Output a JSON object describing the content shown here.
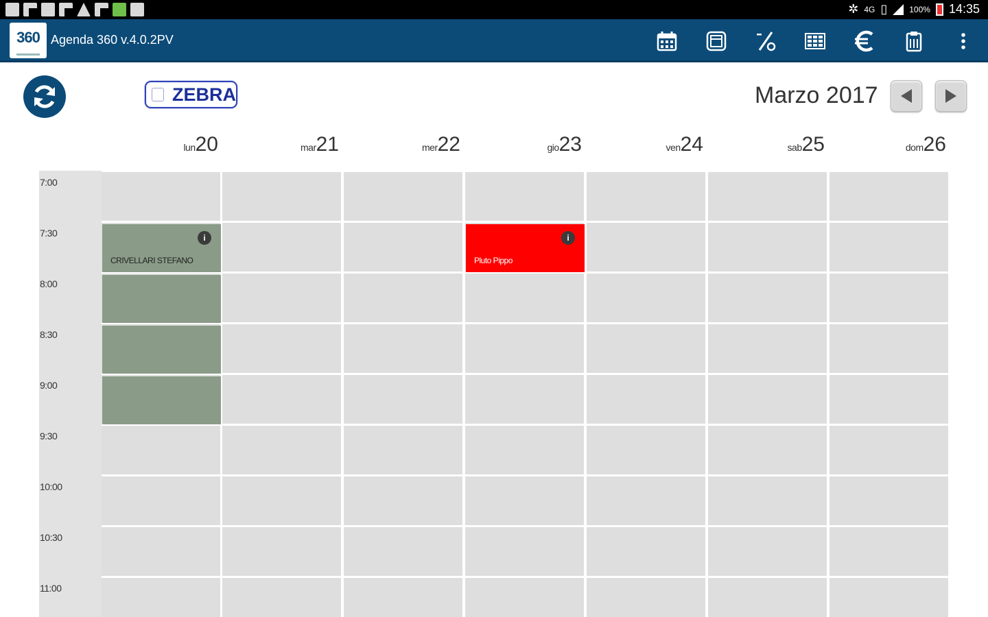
{
  "status_bar": {
    "network": "4G",
    "battery": "100%",
    "time": "14:35"
  },
  "app": {
    "logo_text": "360",
    "title": "Agenda 360  v.4.0.2PV"
  },
  "toolbar": {
    "items": [
      {
        "name": "calendar-icon"
      },
      {
        "name": "list-icon"
      },
      {
        "name": "percent-icon"
      },
      {
        "name": "grid-calendar-icon"
      },
      {
        "name": "euro-icon"
      },
      {
        "name": "clipboard-icon"
      },
      {
        "name": "more-vert-icon"
      }
    ]
  },
  "header": {
    "zebra_label": "ZEBRA",
    "month": "Marzo 2017"
  },
  "days": [
    {
      "name": "lun",
      "num": "20"
    },
    {
      "name": "mar",
      "num": "21"
    },
    {
      "name": "mer",
      "num": "22"
    },
    {
      "name": "gio",
      "num": "23"
    },
    {
      "name": "ven",
      "num": "24"
    },
    {
      "name": "sab",
      "num": "25"
    },
    {
      "name": "dom",
      "num": "26"
    }
  ],
  "times": [
    "7:00",
    "7:30",
    "8:00",
    "8:30",
    "9:00",
    "9:30",
    "10:00",
    "10:30",
    "11:00"
  ],
  "events": [
    {
      "label": "CRIVELLARI STEFANO",
      "info": "i",
      "day_index": 0,
      "slot_start": 1,
      "slots": 1,
      "color": "#8a9c88",
      "text_color": "#222222"
    },
    {
      "label": "",
      "info": "",
      "day_index": 0,
      "slot_start": 2,
      "slots": 1,
      "color": "#8a9c88",
      "text_color": "#222222"
    },
    {
      "label": "",
      "info": "",
      "day_index": 0,
      "slot_start": 3,
      "slots": 1,
      "color": "#8a9c88",
      "text_color": "#222222"
    },
    {
      "label": "",
      "info": "",
      "day_index": 0,
      "slot_start": 4,
      "slots": 1,
      "color": "#8a9c88",
      "text_color": "#222222"
    },
    {
      "label": "Pluto Pippo",
      "info": "i",
      "day_index": 3,
      "slot_start": 1,
      "slots": 1,
      "color": "#ff0000",
      "text_color": "#ffffff"
    }
  ],
  "colors": {
    "app_bar": "#0c4b78",
    "cell": "#dedede",
    "zebra": "#1b2f9a"
  }
}
